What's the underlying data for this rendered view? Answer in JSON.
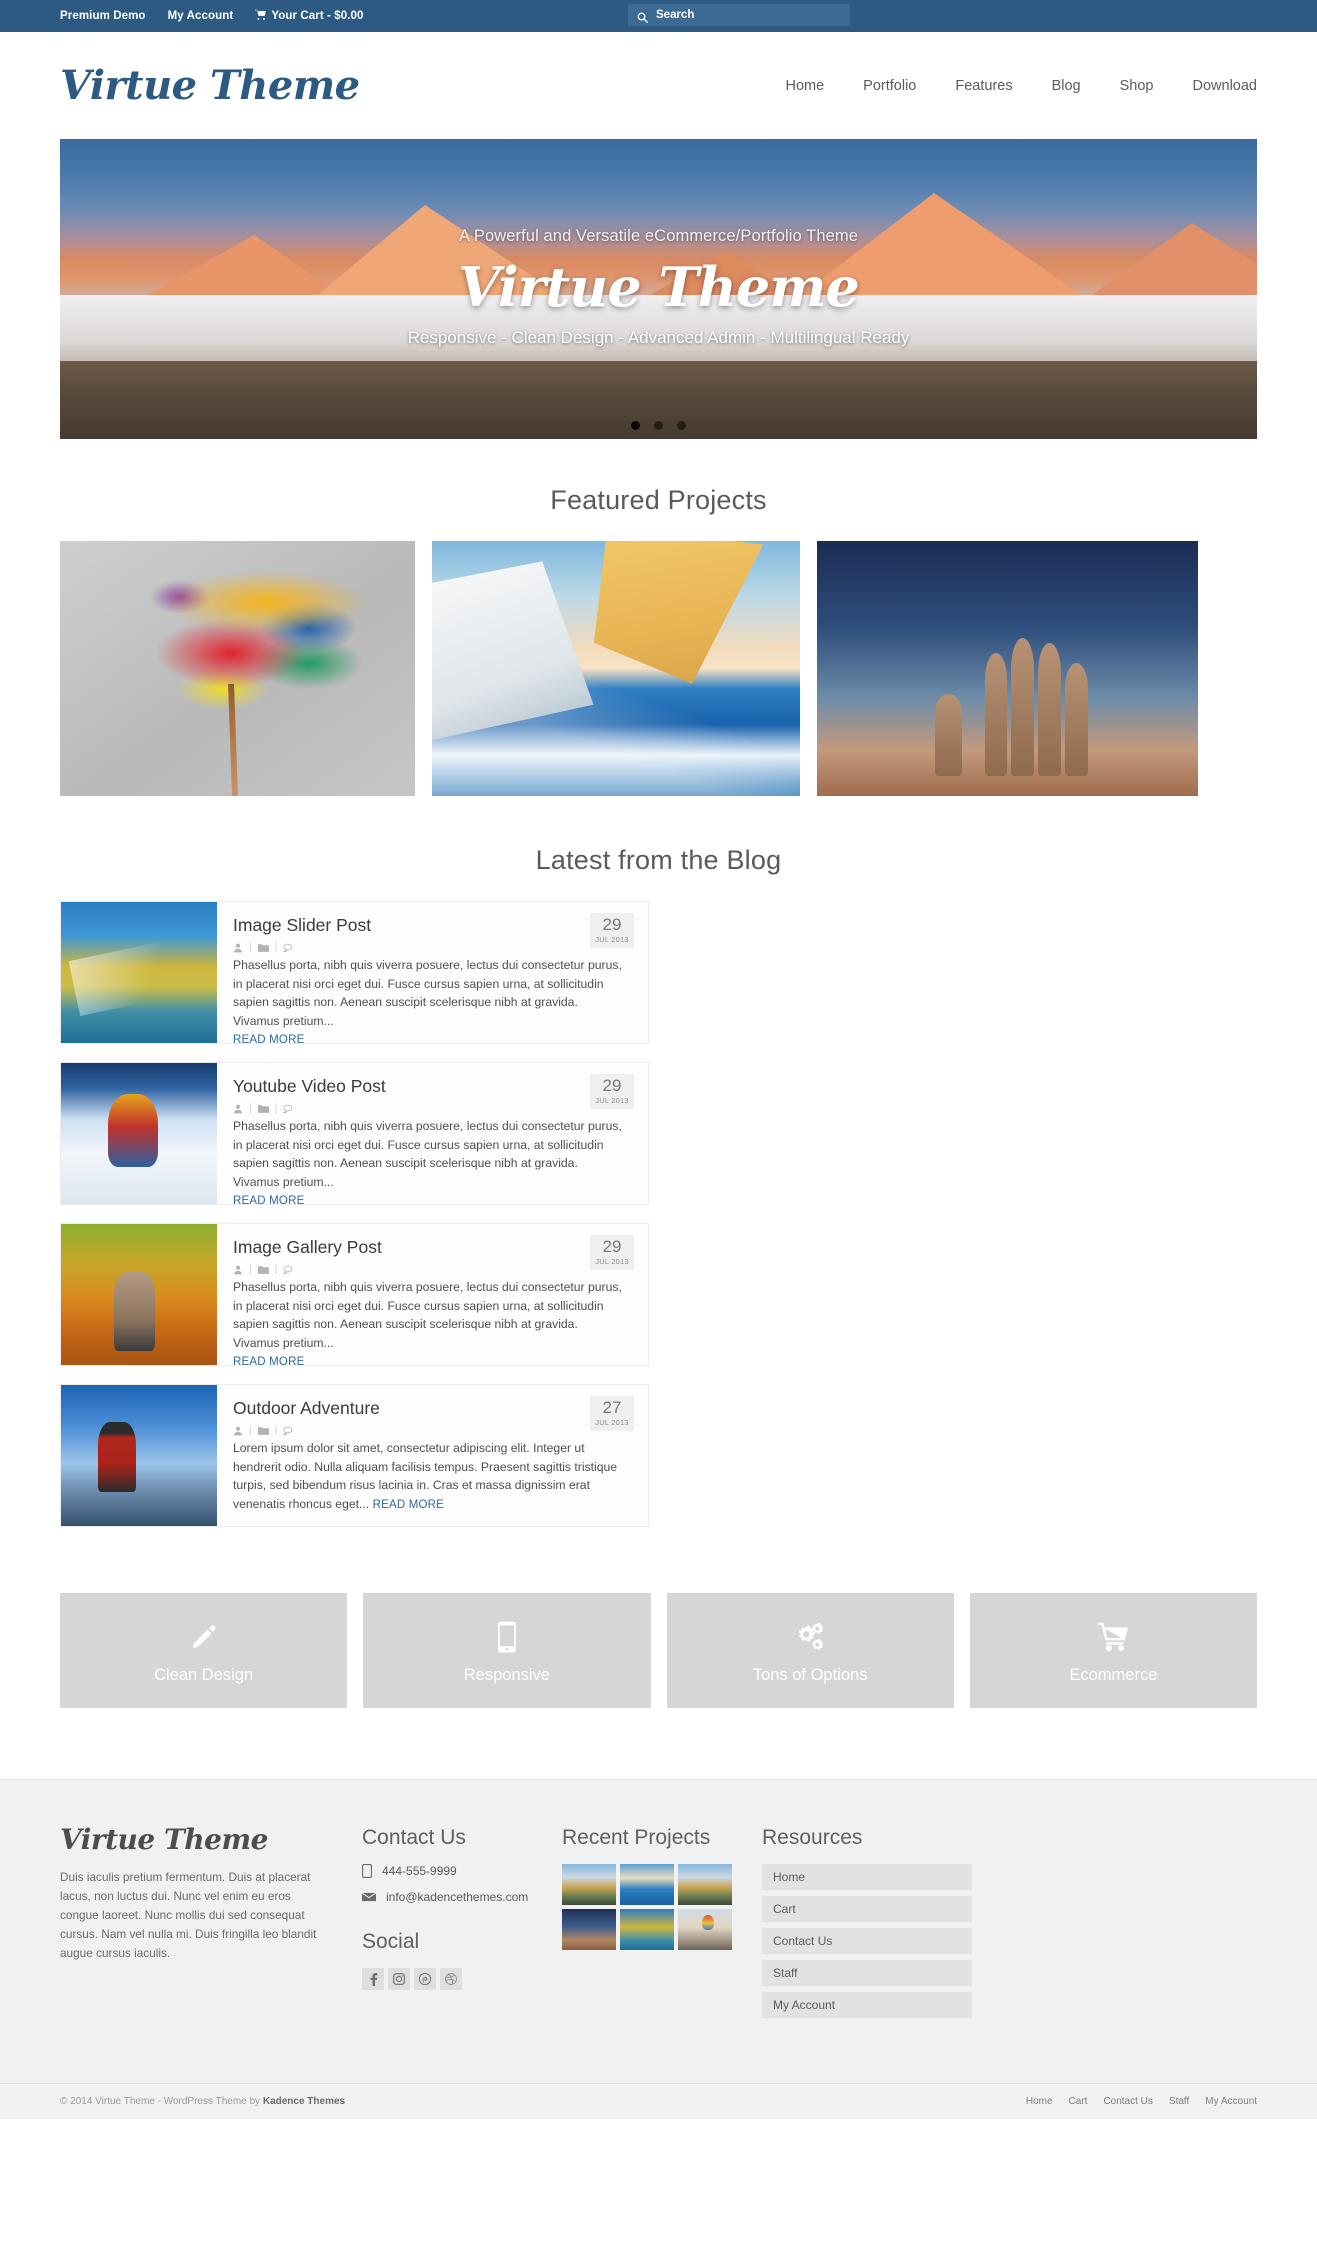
{
  "topbar": {
    "links": [
      {
        "label": "Premium Demo",
        "icon": ""
      },
      {
        "label": "My Account",
        "icon": ""
      },
      {
        "label": "Your Cart - $0.00",
        "icon": "cart-icon"
      }
    ],
    "search": {
      "placeholder": "Search",
      "value": "",
      "icon": "search-icon"
    },
    "bg_color": "#2c5a82"
  },
  "header": {
    "logo": "Virtue Theme",
    "nav": [
      {
        "label": "Home"
      },
      {
        "label": "Portfolio"
      },
      {
        "label": "Features"
      },
      {
        "label": "Blog"
      },
      {
        "label": "Shop"
      },
      {
        "label": "Download"
      }
    ]
  },
  "slider": {
    "subtitle_top": "A Powerful and Versatile eCommerce/Portfolio Theme",
    "title": "Virtue Theme",
    "subtitle_bottom": "Responsive - Clean Design - Advanced Admin - Multilingual Ready",
    "dots": 3,
    "active_dot": 1
  },
  "featured": {
    "title": "Featured Projects",
    "projects": [
      {
        "name": "paint-splash-project"
      },
      {
        "name": "sailboat-project"
      },
      {
        "name": "hand-sculpture-project"
      }
    ]
  },
  "blog": {
    "title": "Latest from the Blog",
    "read_more": "READ MORE",
    "meta_icons": [
      "author-icon",
      "category-icon",
      "comment-icon"
    ],
    "posts": [
      {
        "title": "Image Slider Post",
        "day": "29",
        "month": "JUL 2013",
        "excerpt": "Phasellus porta, nibh quis viverra posuere, lectus dui consectetur purus, in placerat nisi orci eget dui. Fusce cursus sapien urna, at sollicitudin sapien sagittis non. Aenean suscipit scelerisque nibh at gravida. Vivamus pretium...",
        "inline_readmore": false,
        "thumb": "surfer-thumb"
      },
      {
        "title": "Youtube Video Post",
        "day": "29",
        "month": "JUL 2013",
        "excerpt": "Phasellus porta, nibh quis viverra posuere, lectus dui consectetur purus, in placerat nisi orci eget dui. Fusce cursus sapien urna, at sollicitudin sapien sagittis non. Aenean suscipit scelerisque nibh at gravida. Vivamus pretium...",
        "inline_readmore": false,
        "thumb": "snowboarder-thumb"
      },
      {
        "title": "Image Gallery Post",
        "day": "29",
        "month": "JUL 2013",
        "excerpt": "Phasellus porta, nibh quis viverra posuere, lectus dui consectetur purus, in placerat nisi orci eget dui. Fusce cursus sapien urna, at sollicitudin sapien sagittis non. Aenean suscipit scelerisque nibh at gravida. Vivamus pretium...",
        "inline_readmore": false,
        "thumb": "autumn-thumb"
      },
      {
        "title": "Outdoor Adventure",
        "day": "27",
        "month": "JUL 2013",
        "excerpt": "Lorem ipsum dolor sit amet, consectetur adipiscing elit. Integer ut hendrerit odio. Nulla aliquam facilisis tempus. Praesent sagittis tristique turpis, sed bibendum risus lacinia in. Cras et massa dignissim erat venenatis rhoncus eget...",
        "inline_readmore": true,
        "thumb": "mountain-hiker-thumb"
      }
    ]
  },
  "features": {
    "boxes": [
      {
        "label": "Clean Design",
        "icon": "pencil-icon"
      },
      {
        "label": "Responsive",
        "icon": "mobile-icon"
      },
      {
        "label": "Tons of Options",
        "icon": "gears-icon"
      },
      {
        "label": "Ecommerce",
        "icon": "shopping-cart-icon"
      }
    ],
    "bg_color": "#d6d6d6"
  },
  "footer": {
    "logo": "Virtue Theme",
    "about": "Duis iaculis pretium fermentum. Duis at placerat lacus, non luctus dui. Nunc vel enim eu eros congue laoreet. Nunc mollis dui sed consequat cursus. Nam vel nulla mi. Duis fringilla leo blandit augue cursus iaculis.",
    "contact": {
      "heading": "Contact Us",
      "phone": "444-555-9999",
      "phone_icon": "phone-icon",
      "email": "info@kadencethemes.com",
      "email_icon": "envelope-icon"
    },
    "social": {
      "heading": "Social",
      "items": [
        {
          "name": "facebook-icon"
        },
        {
          "name": "instagram-icon"
        },
        {
          "name": "pinterest-icon"
        },
        {
          "name": "dribbble-icon"
        }
      ]
    },
    "recent": {
      "heading": "Recent Projects",
      "thumbs": [
        "lake-mountains",
        "sailboat",
        "lake-mountains-2",
        "hand-sculpture",
        "surfer-wave",
        "hot-air-balloon"
      ]
    },
    "resources": {
      "heading": "Resources",
      "items": [
        {
          "label": "Home"
        },
        {
          "label": "Cart"
        },
        {
          "label": "Contact Us"
        },
        {
          "label": "Staff"
        },
        {
          "label": "My Account"
        }
      ]
    }
  },
  "copyright": {
    "prefix": "© 2014 Virtue Theme - WordPress Theme by ",
    "brand": "Kadence Themes",
    "nav": [
      {
        "label": "Home"
      },
      {
        "label": "Cart"
      },
      {
        "label": "Contact Us"
      },
      {
        "label": "Staff"
      },
      {
        "label": "My Account"
      }
    ]
  }
}
